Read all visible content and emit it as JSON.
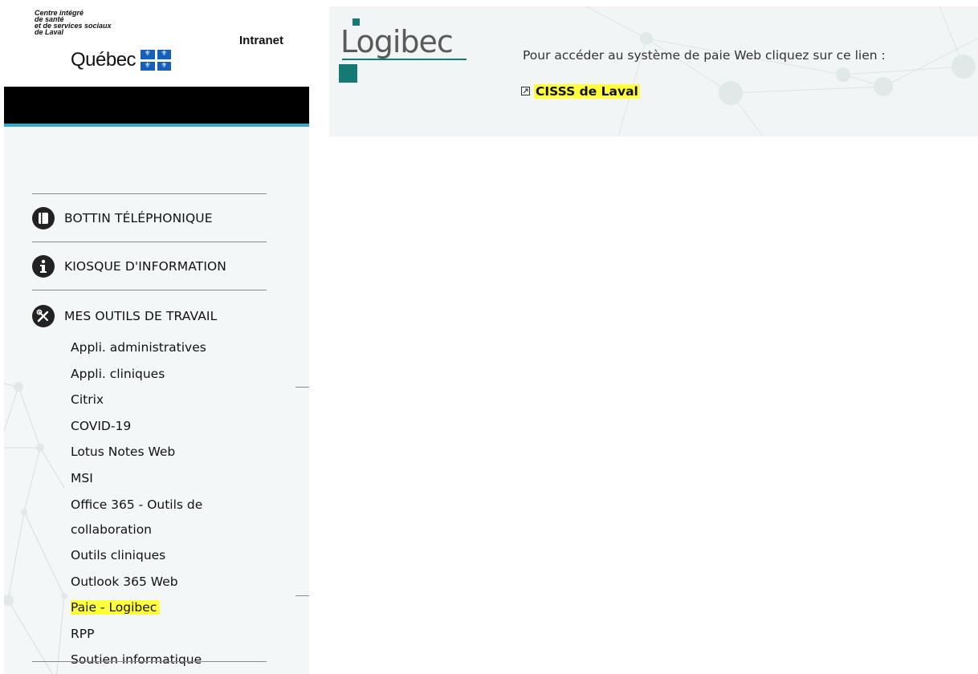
{
  "header": {
    "org_lines": [
      "Centre intégré",
      "de santé",
      "et de services sociaux",
      "de Laval"
    ],
    "quebec_wordmark": "Québec",
    "intranet_label": "Intranet"
  },
  "menu": {
    "items": [
      {
        "label": "BOTTIN TÉLÉPHONIQUE",
        "icon": "book-icon"
      },
      {
        "label": "KIOSQUE D'INFORMATION",
        "icon": "info-icon"
      },
      {
        "label": "MES OUTILS DE TRAVAIL",
        "icon": "tools-icon"
      }
    ],
    "tools_subitems": [
      {
        "label": "Appli. administratives"
      },
      {
        "label": "Appli. cliniques"
      },
      {
        "label": "Citrix"
      },
      {
        "label": "COVID-19"
      },
      {
        "label": "Lotus Notes Web"
      },
      {
        "label": "MSI"
      },
      {
        "label": "Office 365 - Outils de collaboration"
      },
      {
        "label": "Outils cliniques"
      },
      {
        "label": "Outlook 365 Web"
      },
      {
        "label": "Paie - Logibec",
        "highlighted": true
      },
      {
        "label": "RPP"
      },
      {
        "label": "Soutien informatique"
      }
    ]
  },
  "banner": {
    "logo_text": "Logibec",
    "instruction": "Pour accéder au système de paie Web cliquez sur ce lien :",
    "link_label": "CISSS de Laval"
  },
  "colors": {
    "highlight": "#ffff3a",
    "logibec_teal": "#157a73",
    "accent_blue": "#3aa6c9",
    "quebec_blue": "#1560bd"
  }
}
